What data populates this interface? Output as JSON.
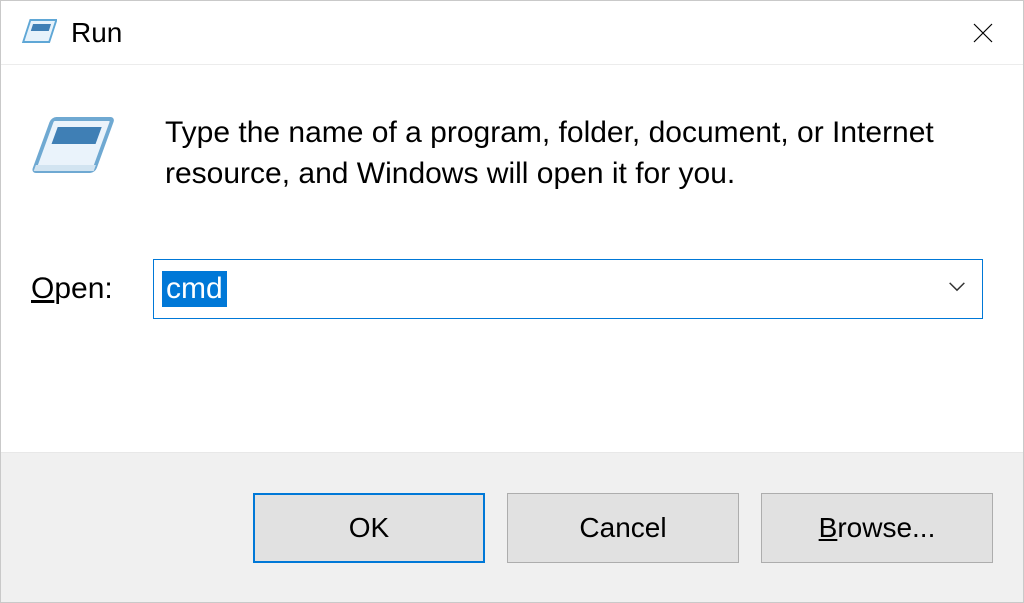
{
  "window": {
    "title": "Run"
  },
  "content": {
    "instruction": "Type the name of a program, folder, document, or Internet resource, and Windows will open it for you."
  },
  "form": {
    "open_label_first": "O",
    "open_label_rest": "pen:",
    "value": "cmd"
  },
  "buttons": {
    "ok": "OK",
    "cancel": "Cancel",
    "browse_first": "B",
    "browse_rest": "rowse..."
  }
}
